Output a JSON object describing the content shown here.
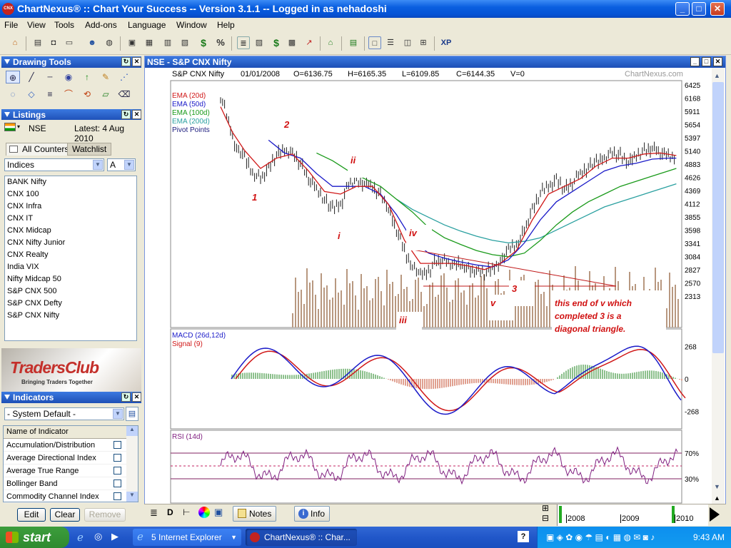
{
  "window": {
    "title": "ChartNexus® :: Chart Your Success -- Version 3.1.1 -- Logged in as nehadoshi",
    "logo": "CNX",
    "minimize": "_",
    "maximize": "□",
    "close": "✕"
  },
  "menu": [
    "File",
    "View",
    "Tools",
    "Add-ons",
    "Language",
    "Window",
    "Help"
  ],
  "toolbar": {
    "xp_label": "XP"
  },
  "drawing_tools": {
    "title": "Drawing Tools"
  },
  "listings": {
    "title": "Listings",
    "exchange": "NSE",
    "latest": "Latest: 4 Aug 2010",
    "tabs": [
      "All Counters",
      "Watchlist"
    ],
    "category": "Indices",
    "letter": "A",
    "items": [
      "BANK Nifty",
      "CNX 100",
      "CNX Infra",
      "CNX IT",
      "CNX Midcap",
      "CNX Nifty Junior",
      "CNX Realty",
      "India VIX",
      "Nifty Midcap 50",
      "S&P CNX 500",
      "S&P CNX Defty",
      "S&P CNX Nifty"
    ]
  },
  "banner": {
    "logo": "TradersClub",
    "tagline": "Bringing Traders Together"
  },
  "indicators": {
    "title": "Indicators",
    "preset": "- System Default -",
    "header": "Name of Indicator",
    "items": [
      "Accumulation/Distribution",
      "Average Directional Index",
      "Average True Range",
      "Bollinger Band",
      "Commodity Channel Index"
    ],
    "buttons": {
      "edit": "Edit",
      "clear": "Clear",
      "remove": "Remove"
    }
  },
  "chart_window": {
    "title": "NSE - S&P CNX Nifty"
  },
  "bottom": {
    "notes": "Notes",
    "info": "Info",
    "d_btn": "D"
  },
  "taskbar": {
    "start": "start",
    "ie_task": "5 Internet Explorer",
    "cn_task": "ChartNexus® :: Char...",
    "time": "9:43 AM"
  },
  "chart_data": [
    {
      "type": "candlestick",
      "symbol": "S&P CNX Nifty",
      "date": "01/01/2008",
      "ohlc": {
        "O": "O=6136.75",
        "H": "H=6165.35",
        "L": "L=6109.85",
        "C": "C=6144.35",
        "V": "V=0"
      },
      "watermark": "ChartNexus.com",
      "legend": [
        {
          "name": "EMA (20d)",
          "color": "#d01818"
        },
        {
          "name": "EMA (50d)",
          "color": "#1a1ac8"
        },
        {
          "name": "EMA (100d)",
          "color": "#1a9a1a"
        },
        {
          "name": "EMA (200d)",
          "color": "#2aa0a0"
        },
        {
          "name": "Pivot Points",
          "color": "#202080"
        }
      ],
      "yticks": [
        "6425",
        "6168",
        "5911",
        "5654",
        "5397",
        "5140",
        "4883",
        "4626",
        "4369",
        "4112",
        "3855",
        "3598",
        "3341",
        "3084",
        "2827",
        "2570",
        "2313"
      ],
      "ylim": [
        2313,
        6425
      ],
      "xticks": [
        "2008",
        "2009",
        "2010"
      ],
      "close_path": [
        [
          0,
          6200
        ],
        [
          4,
          5700
        ],
        [
          8,
          5200
        ],
        [
          12,
          5000
        ],
        [
          16,
          4700
        ],
        [
          20,
          4600
        ],
        [
          24,
          4800
        ],
        [
          28,
          5050
        ],
        [
          32,
          5150
        ],
        [
          36,
          5100
        ],
        [
          40,
          4900
        ],
        [
          44,
          4600
        ],
        [
          48,
          4400
        ],
        [
          52,
          4200
        ],
        [
          56,
          4000
        ],
        [
          60,
          4100
        ],
        [
          64,
          4500
        ],
        [
          68,
          4550
        ],
        [
          72,
          4500
        ],
        [
          76,
          4450
        ],
        [
          80,
          4300
        ],
        [
          84,
          4000
        ],
        [
          88,
          3600
        ],
        [
          92,
          3200
        ],
        [
          96,
          2900
        ],
        [
          100,
          2700
        ],
        [
          104,
          2800
        ],
        [
          108,
          3000
        ],
        [
          112,
          3000
        ],
        [
          116,
          2900
        ],
        [
          120,
          2950
        ],
        [
          124,
          2850
        ],
        [
          128,
          2800
        ],
        [
          132,
          2750
        ],
        [
          136,
          2850
        ],
        [
          140,
          3000
        ],
        [
          144,
          3200
        ],
        [
          148,
          3300
        ],
        [
          152,
          3600
        ],
        [
          156,
          4000
        ],
        [
          160,
          4300
        ],
        [
          164,
          4450
        ],
        [
          168,
          4600
        ],
        [
          172,
          4400
        ],
        [
          176,
          4500
        ],
        [
          180,
          4700
        ],
        [
          184,
          4850
        ],
        [
          188,
          4900
        ],
        [
          192,
          5000
        ],
        [
          196,
          5100
        ],
        [
          200,
          5050
        ],
        [
          204,
          4900
        ],
        [
          208,
          5050
        ],
        [
          212,
          5150
        ],
        [
          216,
          5200
        ],
        [
          220,
          5100
        ],
        [
          224,
          5050
        ],
        [
          228,
          5000
        ]
      ],
      "ema20": [
        [
          0,
          6000
        ],
        [
          6,
          5500
        ],
        [
          12,
          5150
        ],
        [
          20,
          4800
        ],
        [
          28,
          5000
        ],
        [
          36,
          5080
        ],
        [
          44,
          4750
        ],
        [
          52,
          4350
        ],
        [
          60,
          4300
        ],
        [
          68,
          4450
        ],
        [
          76,
          4450
        ],
        [
          84,
          4100
        ],
        [
          92,
          3400
        ],
        [
          100,
          2950
        ],
        [
          108,
          2950
        ],
        [
          116,
          2950
        ],
        [
          124,
          2900
        ],
        [
          132,
          2830
        ],
        [
          140,
          2950
        ],
        [
          148,
          3200
        ],
        [
          156,
          3800
        ],
        [
          164,
          4300
        ],
        [
          172,
          4450
        ],
        [
          180,
          4600
        ],
        [
          188,
          4850
        ],
        [
          196,
          5000
        ],
        [
          204,
          5000
        ],
        [
          212,
          5080
        ],
        [
          220,
          5100
        ],
        [
          228,
          5050
        ]
      ],
      "ema50": [
        [
          24,
          5350
        ],
        [
          32,
          5100
        ],
        [
          40,
          5000
        ],
        [
          48,
          4700
        ],
        [
          56,
          4450
        ],
        [
          64,
          4450
        ],
        [
          72,
          4450
        ],
        [
          80,
          4300
        ],
        [
          88,
          3900
        ],
        [
          96,
          3400
        ],
        [
          104,
          3150
        ],
        [
          112,
          3050
        ],
        [
          120,
          2980
        ],
        [
          128,
          2920
        ],
        [
          136,
          2880
        ],
        [
          144,
          3020
        ],
        [
          152,
          3350
        ],
        [
          160,
          3800
        ],
        [
          168,
          4150
        ],
        [
          176,
          4350
        ],
        [
          184,
          4550
        ],
        [
          192,
          4750
        ],
        [
          200,
          4850
        ],
        [
          208,
          4900
        ],
        [
          216,
          4980
        ],
        [
          224,
          5000
        ],
        [
          228,
          5000
        ]
      ],
      "ema100": [
        [
          48,
          5100
        ],
        [
          56,
          4950
        ],
        [
          64,
          4750
        ],
        [
          72,
          4600
        ],
        [
          80,
          4450
        ],
        [
          88,
          4200
        ],
        [
          96,
          3950
        ],
        [
          104,
          3650
        ],
        [
          112,
          3450
        ],
        [
          120,
          3320
        ],
        [
          128,
          3200
        ],
        [
          136,
          3120
        ],
        [
          144,
          3080
        ],
        [
          152,
          3150
        ],
        [
          160,
          3400
        ],
        [
          168,
          3700
        ],
        [
          176,
          3950
        ],
        [
          184,
          4150
        ],
        [
          192,
          4300
        ],
        [
          200,
          4450
        ],
        [
          208,
          4550
        ],
        [
          216,
          4650
        ],
        [
          224,
          4750
        ],
        [
          228,
          4800
        ]
      ],
      "ema200": [
        [
          88,
          4200
        ],
        [
          96,
          4000
        ],
        [
          104,
          3850
        ],
        [
          112,
          3700
        ],
        [
          120,
          3580
        ],
        [
          128,
          3480
        ],
        [
          136,
          3400
        ],
        [
          144,
          3350
        ],
        [
          152,
          3380
        ],
        [
          160,
          3450
        ],
        [
          168,
          3600
        ],
        [
          176,
          3750
        ],
        [
          184,
          3900
        ],
        [
          192,
          4050
        ],
        [
          200,
          4150
        ],
        [
          208,
          4250
        ],
        [
          216,
          4350
        ],
        [
          224,
          4450
        ],
        [
          228,
          4500
        ]
      ],
      "wave_labels": [
        "1",
        "2",
        "i",
        "ii",
        "iii",
        "iv",
        "v",
        "3"
      ],
      "annotation": [
        "this end of v which",
        "completed 3 is a",
        "diagonal triangle."
      ]
    },
    {
      "type": "line",
      "title": "MACD (26d,12d)",
      "series": [
        {
          "name": "MACD (26d,12d)",
          "color": "#1a1ac8"
        },
        {
          "name": "Signal (9)",
          "color": "#d01818"
        }
      ],
      "yticks": [
        "268",
        "0",
        "-268"
      ],
      "ylim": [
        -400,
        400
      ]
    },
    {
      "type": "line",
      "title": "RSI (14d)",
      "series": [
        {
          "name": "RSI (14d)",
          "color": "#802080"
        }
      ],
      "yticks": [
        "70%",
        "30%"
      ],
      "ylim": [
        0,
        100
      ]
    }
  ]
}
